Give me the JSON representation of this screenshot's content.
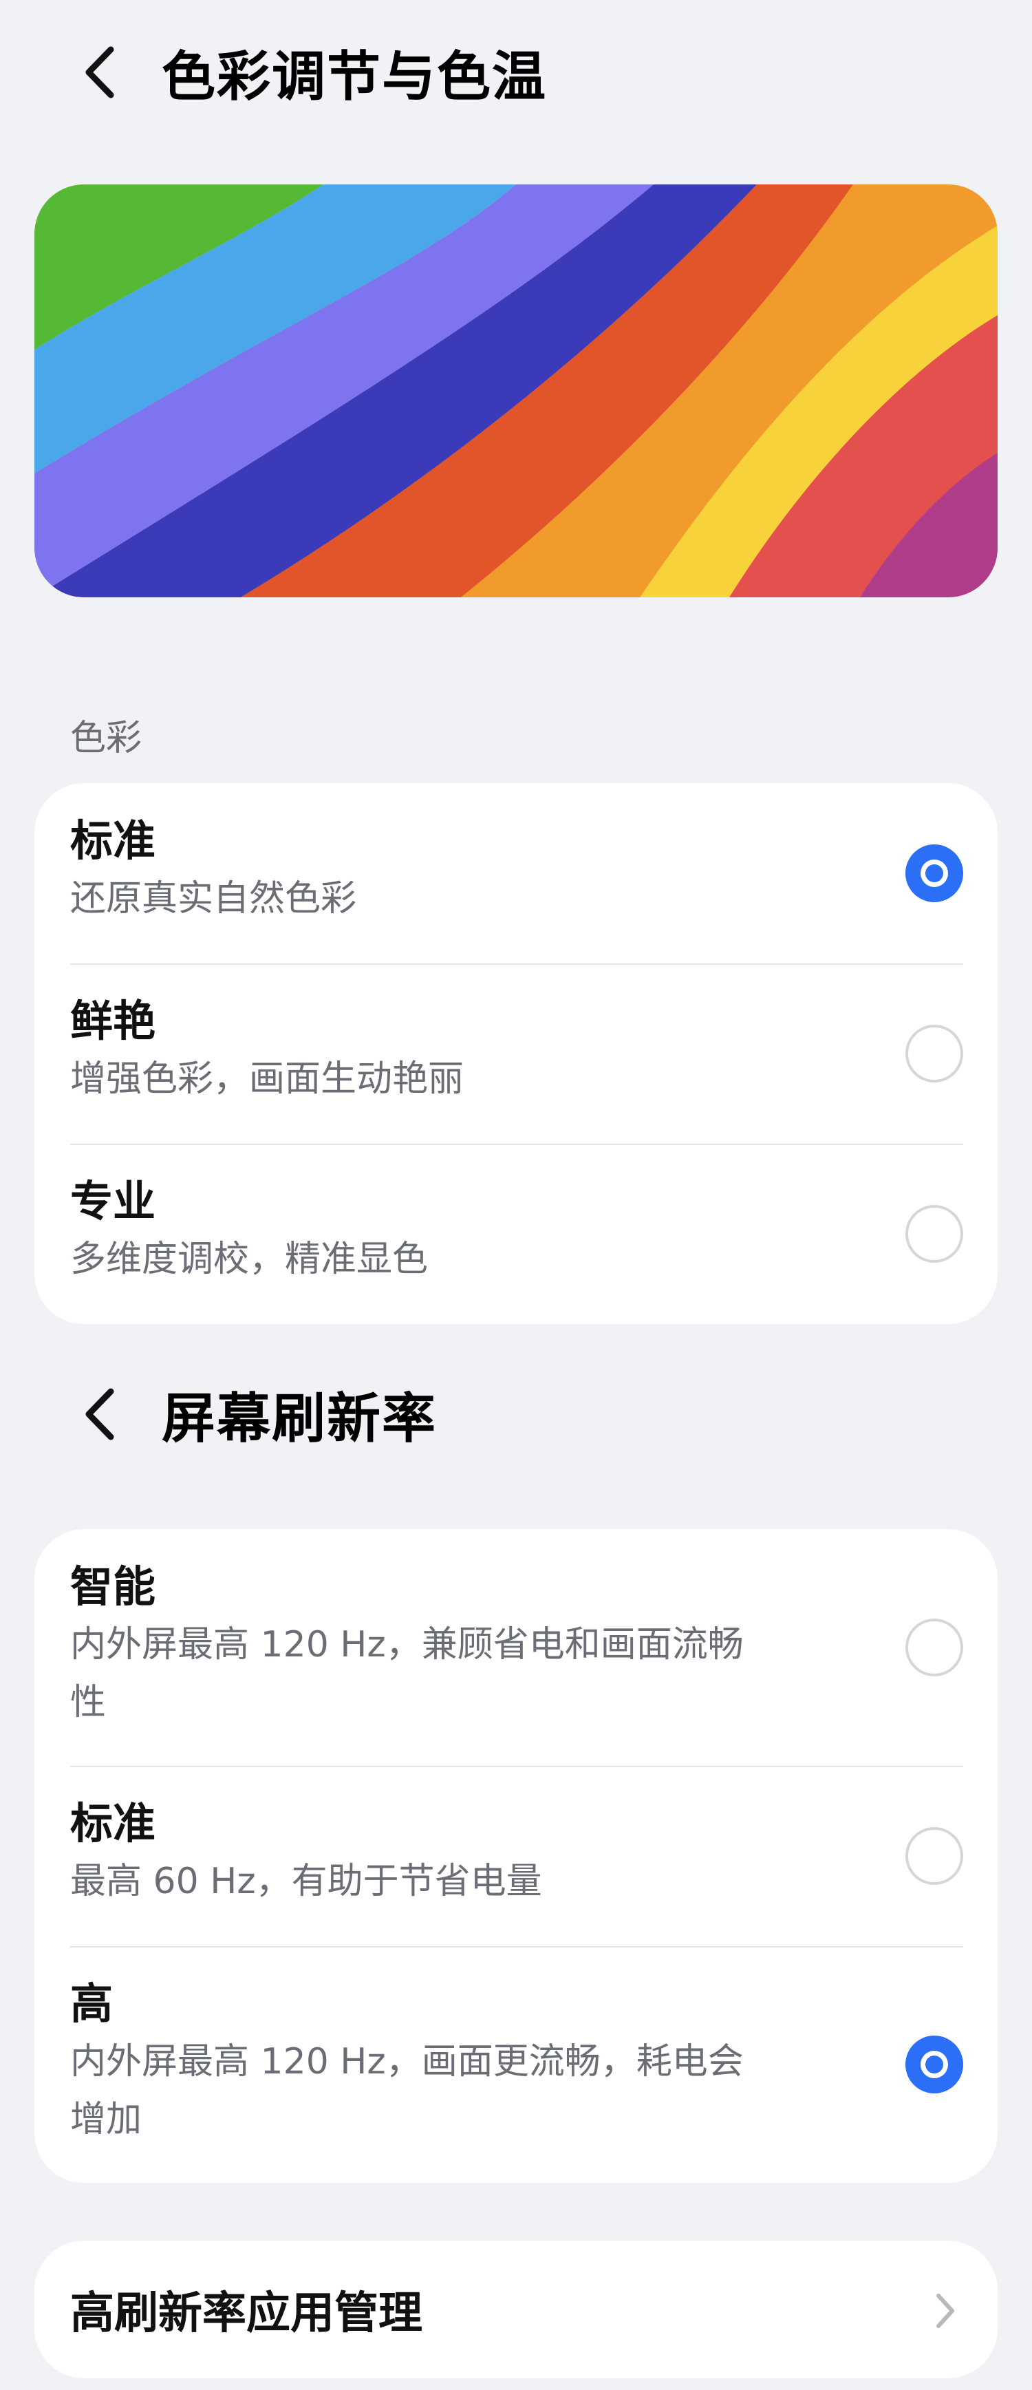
{
  "color_header": {
    "title": "色彩调节与色温"
  },
  "color_section": {
    "label": "色彩",
    "options": [
      {
        "title": "标准",
        "desc": "还原真实自然色彩",
        "selected": true
      },
      {
        "title": "鲜艳",
        "desc": "增强色彩，画面生动艳丽",
        "selected": false
      },
      {
        "title": "专业",
        "desc": "多维度调校，精准显色",
        "selected": false
      }
    ]
  },
  "refresh_header": {
    "title": "屏幕刷新率"
  },
  "refresh_section": {
    "options": [
      {
        "title": "智能",
        "desc_line1": "内外屏最高 120 Hz，兼顾省电和画面流畅",
        "desc_line2": "性",
        "selected": false
      },
      {
        "title": "标准",
        "desc_line1": "最高 60 Hz，有助于节省电量",
        "selected": false
      },
      {
        "title": "高",
        "desc_line1": "内外屏最高 120 Hz，画面更流畅，耗电会",
        "desc_line2": "增加",
        "selected": true
      }
    ]
  },
  "app_management": {
    "label": "高刷新率应用管理",
    "icon": "chevron-right-icon"
  },
  "icons": {
    "back": "chevron-left-icon"
  },
  "colors": {
    "accent": "#2a6ff5",
    "background": "#f1f2f6",
    "card": "#ffffff"
  }
}
